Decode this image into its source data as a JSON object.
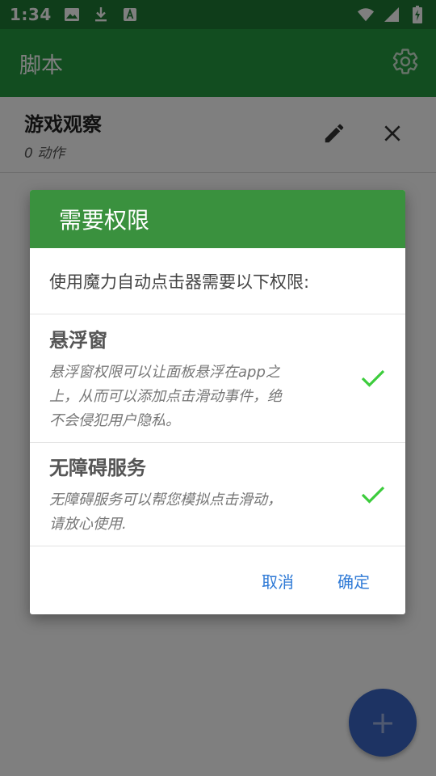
{
  "status_bar": {
    "time": "1:34",
    "icons": [
      "image-icon",
      "download-icon",
      "keyboard-a-icon",
      "wifi-icon",
      "signal-icon",
      "battery-charging-icon"
    ]
  },
  "app_bar": {
    "title": "脚本",
    "settings_icon": "gear-icon"
  },
  "script_list": {
    "items": [
      {
        "name": "游戏观察",
        "count": "0 动作"
      }
    ]
  },
  "dialog": {
    "title": "需要权限",
    "intro": "使用魔力自动点击器需要以下权限:",
    "permissions": [
      {
        "title": "悬浮窗",
        "description_line1": "悬浮窗权限可以让面板悬浮在app之",
        "description_line2": "上，从而可以添加点击滑动事件，绝",
        "description_line3": "不会侵犯用户隐私。",
        "granted": true
      },
      {
        "title": "无障碍服务",
        "description_line1": "无障碍服务可以帮您模拟点击滑动，",
        "description_line2": "请放心使用.",
        "granted": true
      }
    ],
    "cancel_label": "取消",
    "confirm_label": "确定"
  },
  "fab": {
    "symbol": "+"
  },
  "colors": {
    "status_bar": "#1e7b34",
    "app_bar": "#259b41",
    "dialog_header": "#3a913e",
    "check": "#3ccc3c",
    "action_text": "#2f7ad6",
    "fab": "#3a66c6"
  }
}
